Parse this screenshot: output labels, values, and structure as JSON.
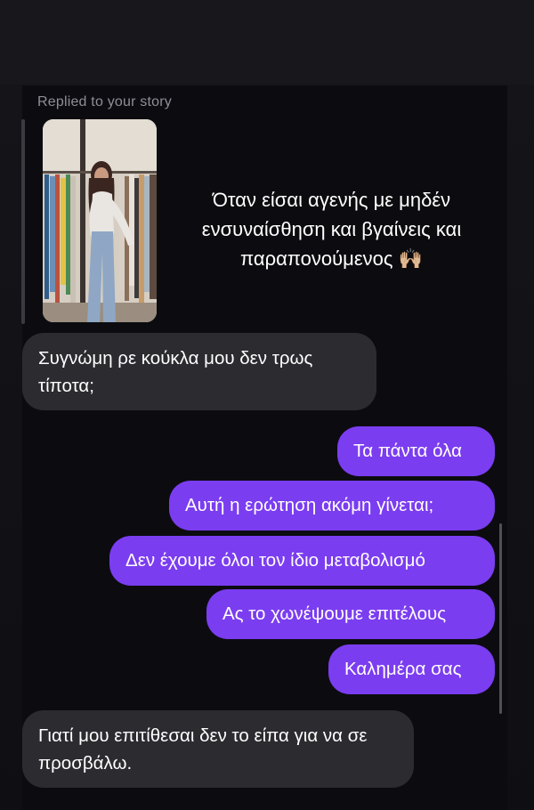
{
  "story_reply": {
    "label": "Replied to your story",
    "caption": "Όταν είσαι αγενής με μηδέν ενσυναίσθηση και βγαίνεις και παραπονούμενος 🙌🏼"
  },
  "messages": [
    {
      "direction": "incoming",
      "text": "Συγνώμη ρε κούκλα μου δεν τρως τίποτα;"
    },
    {
      "direction": "outgoing",
      "text": "Τα πάντα όλα"
    },
    {
      "direction": "outgoing",
      "text": "Αυτή η ερώτηση ακόμη γίνεται;"
    },
    {
      "direction": "outgoing",
      "text": "Δεν έχουμε όλοι τον ίδιο μεταβολισμό"
    },
    {
      "direction": "outgoing",
      "text": "Ας το χωνέψουμε επιτέλους"
    },
    {
      "direction": "outgoing",
      "text": "Καλημέρα σας"
    },
    {
      "direction": "incoming",
      "text": "Γιατί μου επιτίθεσαι δεν το είπα για να σε προσβάλω."
    }
  ],
  "colors": {
    "outgoing_bubble": "#7b3df0",
    "incoming_bubble": "#2b2b30",
    "background": "#0c0c10"
  }
}
